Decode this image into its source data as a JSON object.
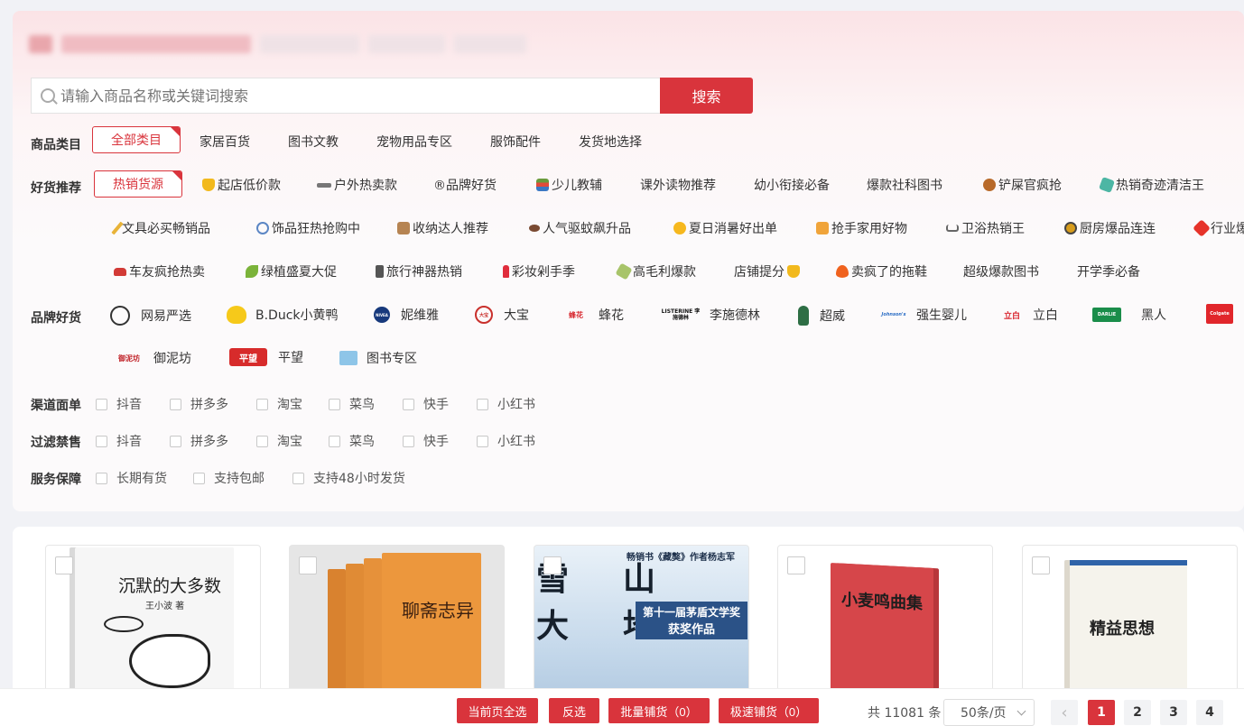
{
  "search": {
    "placeholder": "请输入商品名称或关键词搜索",
    "button": "搜索"
  },
  "category": {
    "label": "商品类目",
    "items": [
      "全部类目",
      "家居百货",
      "图书文教",
      "宠物用品专区",
      "服饰配件",
      "发货地选择"
    ]
  },
  "recommend": {
    "label": "好货推荐",
    "items": [
      {
        "text": "热销货源",
        "icon": ""
      },
      {
        "text": "起店低价款",
        "icon": "shield-icon"
      },
      {
        "text": "户外热卖款",
        "icon": "flashlight-icon"
      },
      {
        "text": "®品牌好货",
        "icon": ""
      },
      {
        "text": "少儿教辅",
        "icon": "books-icon"
      },
      {
        "text": "课外读物推荐",
        "icon": ""
      },
      {
        "text": "幼小衔接必备",
        "icon": ""
      },
      {
        "text": "爆款社科图书",
        "icon": ""
      },
      {
        "text": "铲屎官疯抢",
        "icon": "paw-icon"
      },
      {
        "text": "热销奇迹清洁王",
        "icon": "sponge-icon"
      },
      {
        "text": "文具必买畅销品",
        "icon": "pencil-icon"
      },
      {
        "text": "饰品狂热抢购中",
        "icon": "ring-icon"
      },
      {
        "text": "收纳达人推荐",
        "icon": "box-icon"
      },
      {
        "text": "人气驱蚊飙升品",
        "icon": "mosquito-icon"
      },
      {
        "text": "夏日消暑好出单",
        "icon": "sun-icon"
      },
      {
        "text": "抢手家用好物",
        "icon": "gift-icon"
      },
      {
        "text": "卫浴热销王",
        "icon": "bathtub-icon"
      },
      {
        "text": "厨房爆品连连",
        "icon": "pan-icon"
      },
      {
        "text": "行业爆",
        "icon": "burst-icon"
      },
      {
        "text": "车友疯抢热卖",
        "icon": "car-icon"
      },
      {
        "text": "绿植盛夏大促",
        "icon": "sprout-icon"
      },
      {
        "text": "旅行神器热销",
        "icon": "phone-icon"
      },
      {
        "text": "彩妆剁手季",
        "icon": "lipstick-icon"
      },
      {
        "text": "高毛利爆款",
        "icon": "money-icon"
      },
      {
        "text": "店铺提分",
        "icon": "shield-icon"
      },
      {
        "text": "卖疯了的拖鞋",
        "icon": "fire-icon"
      },
      {
        "text": "超级爆款图书",
        "icon": ""
      },
      {
        "text": "开学季必备",
        "icon": ""
      }
    ]
  },
  "brands": {
    "label": "品牌好货",
    "items": [
      {
        "name": "网易严选",
        "logo": "⊕"
      },
      {
        "name": "B.Duck小黄鸭",
        "logo": ""
      },
      {
        "name": "妮维雅",
        "logo": "NIVEA"
      },
      {
        "name": "大宝",
        "logo": "大宝"
      },
      {
        "name": "蜂花",
        "logo": "蜂花"
      },
      {
        "name": "李施德林",
        "logo": "LISTERINE 李施德林"
      },
      {
        "name": "超威",
        "logo": ""
      },
      {
        "name": "强生婴儿",
        "logo": "Johnson's"
      },
      {
        "name": "立白",
        "logo": "立白"
      },
      {
        "name": "黑人",
        "logo": "DARLIE"
      },
      {
        "name": "",
        "logo": "Colgate"
      },
      {
        "name": "御泥坊",
        "logo": "御泥坊"
      },
      {
        "name": "平望",
        "logo": "平望"
      },
      {
        "name": "图书专区",
        "logo": ""
      }
    ]
  },
  "channel": {
    "label": "渠道面单",
    "options": [
      "抖音",
      "拼多多",
      "淘宝",
      "菜鸟",
      "快手",
      "小红书"
    ]
  },
  "filter": {
    "label": "过滤禁售",
    "options": [
      "抖音",
      "拼多多",
      "淘宝",
      "菜鸟",
      "快手",
      "小红书"
    ]
  },
  "service": {
    "label": "服务保障",
    "options": [
      "长期有货",
      "支持包邮",
      "支持48小时发货"
    ]
  },
  "products": [
    {
      "title": "沉默的大多数",
      "author": "王小波 著",
      "cover_color": "#f4f4f4"
    },
    {
      "title": "聊斋志异",
      "author": "",
      "cover_color": "#e9953e"
    },
    {
      "title": "雪山大地",
      "author": "",
      "cover_color": "#cfe0f0",
      "tagline": "第十一届茅盾文学奖",
      "tagline2": "获奖作品",
      "header_text": "畅销书《藏獒》作者杨志军"
    },
    {
      "title": "小麦鸣曲集",
      "author": "",
      "cover_color": "#d8484a"
    },
    {
      "title": "精益思想",
      "author": "",
      "cover_color": "#f5f3ec"
    }
  ],
  "bottom": {
    "select_page": "当前页全选",
    "invert": "反选",
    "batch": "批量铺货（0）",
    "fast": "极速铺货（0）",
    "total": "共 11081 条",
    "per_page": "50条/页",
    "pages": [
      "1",
      "2",
      "3",
      "4"
    ],
    "prev": "‹"
  },
  "colors": {
    "accent": "#d9343c"
  }
}
